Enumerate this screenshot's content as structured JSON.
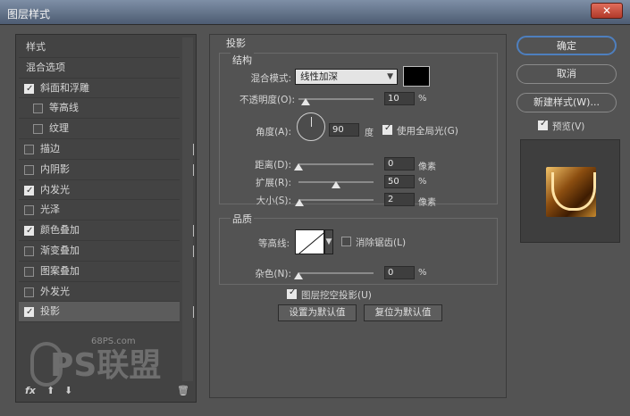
{
  "window": {
    "title": "图层样式",
    "close_label": "✕"
  },
  "styles_list": [
    {
      "label": "样式",
      "checkbox": false,
      "checked": false,
      "indent": false,
      "plus": false,
      "selected": false
    },
    {
      "label": "混合选项",
      "checkbox": false,
      "checked": false,
      "indent": false,
      "plus": false,
      "selected": false
    },
    {
      "label": "斜面和浮雕",
      "checkbox": true,
      "checked": true,
      "indent": false,
      "plus": false,
      "selected": false
    },
    {
      "label": "等高线",
      "checkbox": true,
      "checked": false,
      "indent": true,
      "plus": false,
      "selected": false
    },
    {
      "label": "纹理",
      "checkbox": true,
      "checked": false,
      "indent": true,
      "plus": false,
      "selected": false
    },
    {
      "label": "描边",
      "checkbox": true,
      "checked": false,
      "indent": false,
      "plus": true,
      "selected": false
    },
    {
      "label": "内阴影",
      "checkbox": true,
      "checked": false,
      "indent": false,
      "plus": true,
      "selected": false
    },
    {
      "label": "内发光",
      "checkbox": true,
      "checked": true,
      "indent": false,
      "plus": false,
      "selected": false
    },
    {
      "label": "光泽",
      "checkbox": true,
      "checked": false,
      "indent": false,
      "plus": false,
      "selected": false
    },
    {
      "label": "颜色叠加",
      "checkbox": true,
      "checked": true,
      "indent": false,
      "plus": true,
      "selected": false
    },
    {
      "label": "渐变叠加",
      "checkbox": true,
      "checked": false,
      "indent": false,
      "plus": true,
      "selected": false
    },
    {
      "label": "图案叠加",
      "checkbox": true,
      "checked": false,
      "indent": false,
      "plus": false,
      "selected": false
    },
    {
      "label": "外发光",
      "checkbox": true,
      "checked": false,
      "indent": false,
      "plus": false,
      "selected": false
    },
    {
      "label": "投影",
      "checkbox": true,
      "checked": true,
      "indent": false,
      "plus": true,
      "selected": true
    }
  ],
  "left_footer": {
    "fx": "fx",
    "up": "⬆",
    "down": "⬇",
    "trash": "🗑"
  },
  "drop_shadow": {
    "title": "投影",
    "structure_title": "结构",
    "blend_mode_label": "混合模式:",
    "blend_mode_value": "线性加深",
    "opacity_label": "不透明度(O):",
    "opacity_value": "10",
    "opacity_fraction": 0.1,
    "percent": "%",
    "angle_label": "角度(A):",
    "angle_value": "90",
    "degree": "度",
    "global_light_label": "使用全局光(G)",
    "global_light_checked": true,
    "distance_label": "距离(D):",
    "distance_value": "0",
    "distance_fraction": 0.0,
    "spread_label": "扩展(R):",
    "spread_value": "50",
    "spread_fraction": 0.5,
    "size_label": "大小(S):",
    "size_value": "2",
    "size_fraction": 0.01,
    "pixels": "像素",
    "quality_title": "品质",
    "contour_label": "等高线:",
    "antialias_label": "消除锯齿(L)",
    "antialias_checked": false,
    "noise_label": "杂色(N):",
    "noise_value": "0",
    "noise_fraction": 0.0,
    "knockout_label": "图层挖空投影(U)",
    "knockout_checked": true,
    "set_default_label": "设置为默认值",
    "reset_default_label": "复位为默认值"
  },
  "right_buttons": {
    "ok": "确定",
    "cancel": "取消",
    "new_style": "新建样式(W)...",
    "preview_label": "预览(V)",
    "preview_checked": true
  },
  "watermark": {
    "site": "68PS.com",
    "text": "PS联盟"
  },
  "colors": {
    "shadow_color": "#000000",
    "accent": "#4e7fbe"
  }
}
